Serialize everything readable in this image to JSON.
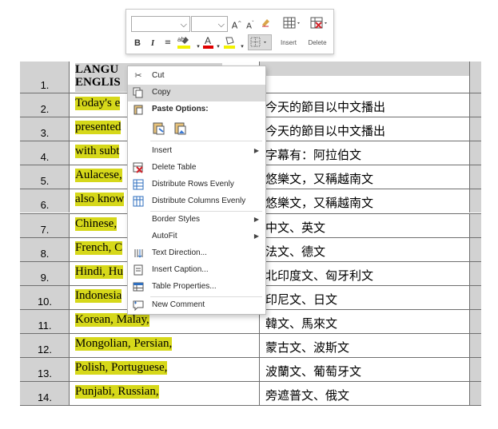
{
  "toolbar": {
    "font_name": "",
    "font_size": "",
    "grow_font": "A",
    "shrink_font": "A",
    "bold": "B",
    "italic": "I",
    "insert_label": "Insert",
    "delete_label": "Delete",
    "colors": {
      "font_color": "#e00000",
      "highlight": "#f2f200",
      "shading": "#f2f200"
    }
  },
  "table": {
    "header": {
      "number": "1.",
      "english": "LANGUAGES TO BE USED IN ENGLISH",
      "english_visible_line1": "LANGU",
      "english_visible_line2": "ENGLIS",
      "chinese": ""
    },
    "rows": [
      {
        "number": "2.",
        "english": "Today's e",
        "chinese": "今天的節目以中文播出"
      },
      {
        "number": "3.",
        "english": "presented",
        "chinese": "今天的節目以中文播出"
      },
      {
        "number": "4.",
        "english": "with subt",
        "chinese": "字幕有：阿拉伯文"
      },
      {
        "number": "5.",
        "english": "Aulacese,",
        "chinese": "悠樂文，又稱越南文"
      },
      {
        "number": "6.",
        "english": "also know",
        "chinese": "悠樂文，又稱越南文"
      },
      {
        "number": "7.",
        "english": "Chinese, ",
        "chinese": "中文、英文"
      },
      {
        "number": "8.",
        "english": "French, C",
        "chinese": "法文、德文"
      },
      {
        "number": "9.",
        "english": "Hindi, Hu",
        "chinese": "北印度文、匈牙利文"
      },
      {
        "number": "10.",
        "english": "Indonesia",
        "chinese": "印尼文、日文"
      },
      {
        "number": "11.",
        "english": "Korean, Malay,",
        "chinese": "韓文、馬來文"
      },
      {
        "number": "12.",
        "english": "Mongolian, Persian,",
        "chinese": "蒙古文、波斯文"
      },
      {
        "number": "13.",
        "english": "Polish, Portuguese,",
        "chinese": "波蘭文、葡萄牙文"
      },
      {
        "number": "14.",
        "english": "Punjabi, Russian,",
        "chinese": "旁遮普文、俄文"
      }
    ]
  },
  "context_menu": {
    "cut": "Cut",
    "copy": "Copy",
    "paste_options": "Paste Options:",
    "insert": "Insert",
    "delete_table": "Delete Table",
    "distribute_rows": "Distribute Rows Evenly",
    "distribute_columns": "Distribute Columns Evenly",
    "border_styles": "Border Styles",
    "autofit": "AutoFit",
    "text_direction": "Text Direction...",
    "insert_caption": "Insert Caption...",
    "table_properties": "Table Properties...",
    "new_comment": "New Comment"
  },
  "colors": {
    "highlight": "#d6d81a",
    "shaded_cell": "#d2d2d2",
    "menu_hover": "#d9d9d9"
  }
}
